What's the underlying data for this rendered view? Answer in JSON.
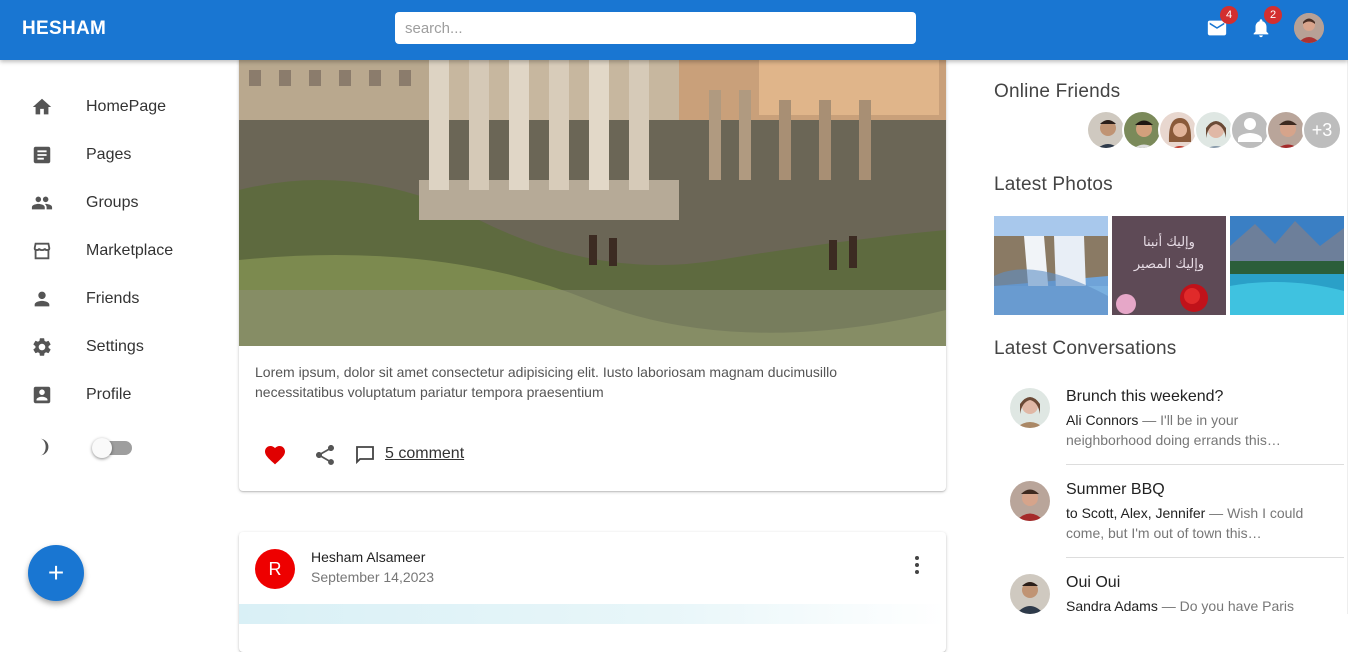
{
  "appbar": {
    "brand": "HESHAM",
    "search_placeholder": "search...",
    "mail_count": "4",
    "notifications_count": "2"
  },
  "sidebar": {
    "items": [
      {
        "label": "HomePage",
        "icon": "home-icon"
      },
      {
        "label": "Pages",
        "icon": "article-icon"
      },
      {
        "label": "Groups",
        "icon": "group-icon"
      },
      {
        "label": "Marketplace",
        "icon": "storefront-icon"
      },
      {
        "label": "Friends",
        "icon": "person-icon"
      },
      {
        "label": "Settings",
        "icon": "gear-icon"
      },
      {
        "label": "Profile",
        "icon": "account-box-icon"
      }
    ],
    "dark_mode": false
  },
  "feed": {
    "post1": {
      "text": "Lorem ipsum, dolor sit amet consectetur adipisicing elit. Iusto laboriosam magnam ducimusillo necessitatibus voluptatum pariatur tempora praesentium",
      "comments": "5 comment",
      "liked": true
    },
    "post2": {
      "avatar_letter": "R",
      "author": "Hesham Alsameer",
      "date": "September 14,2023"
    }
  },
  "right": {
    "online_title": "Online Friends",
    "more_friends": "+3",
    "photos_title": "Latest Photos",
    "conversations_title": "Latest Conversations",
    "conversations": [
      {
        "title": "Brunch this weekend?",
        "from": "Ali Connors",
        "text": " — I'll be in your neighborhood doing errands this…"
      },
      {
        "title": "Summer BBQ",
        "from": "to Scott, Alex, Jennifer",
        "text": " — Wish I could come, but I'm out of town this…"
      },
      {
        "title": "Oui Oui",
        "from": "Sandra Adams",
        "text": " — Do you have Paris"
      }
    ]
  },
  "colors": {
    "primary": "#1976d2",
    "badge": "#d32f2f",
    "like": "#e00000"
  }
}
